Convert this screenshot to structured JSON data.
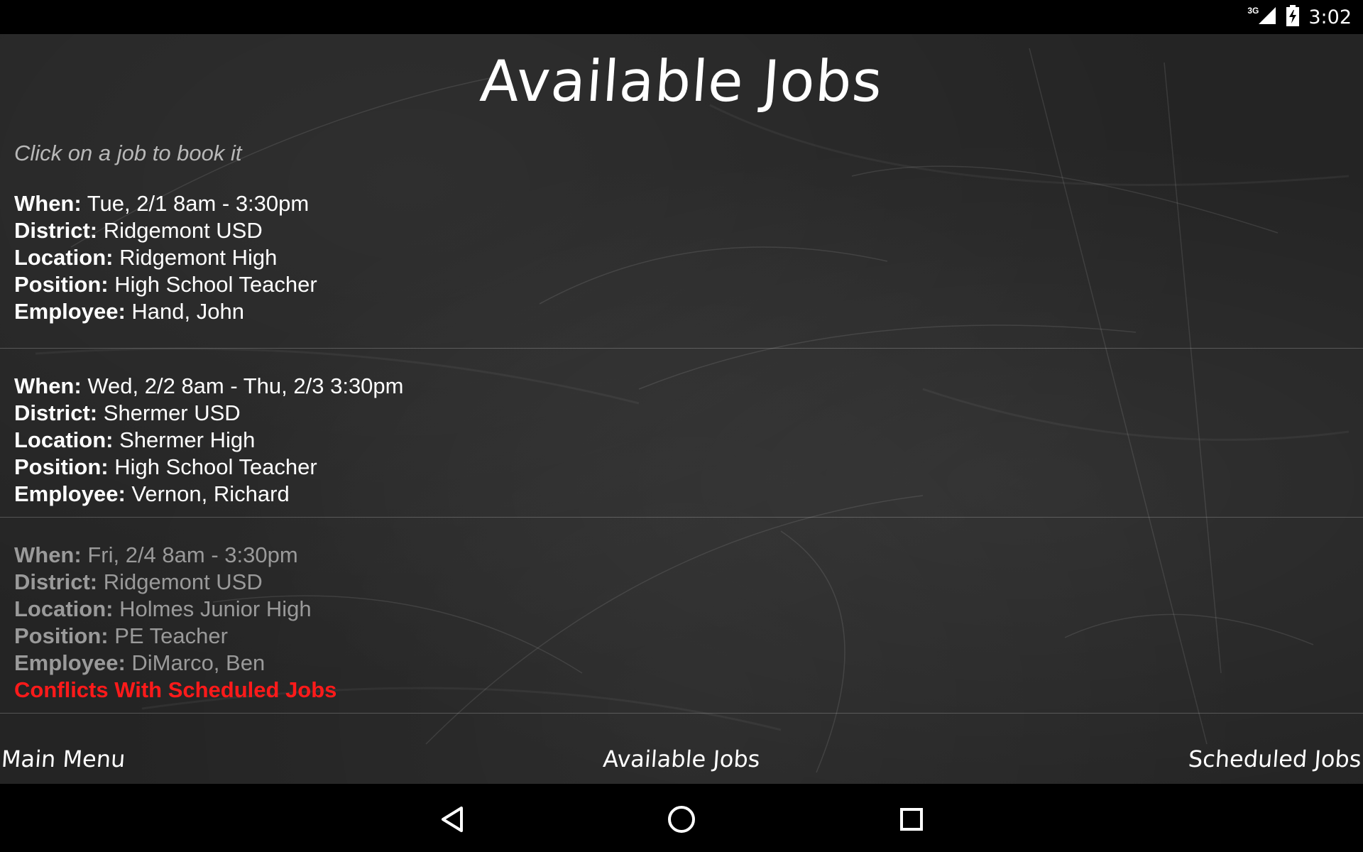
{
  "status_bar": {
    "network_type": "3G",
    "time": "3:02",
    "icons": [
      "signal-icon",
      "battery-icon"
    ]
  },
  "title": "Available Jobs",
  "hint": "Click on a job to book it",
  "labels": {
    "when": "When:",
    "district": "District:",
    "location": "Location:",
    "position": "Position:",
    "employee": "Employee:"
  },
  "jobs": [
    {
      "when": "Tue, 2/1 8am - 3:30pm",
      "district": "Ridgemont USD",
      "location": "Ridgemont High",
      "position": "High School Teacher",
      "employee": "Hand, John",
      "conflict": ""
    },
    {
      "when": "Wed, 2/2 8am - Thu, 2/3 3:30pm",
      "district": "Shermer USD",
      "location": "Shermer High",
      "position": "High School Teacher",
      "employee": "Vernon, Richard",
      "conflict": ""
    },
    {
      "when": "Fri, 2/4 8am - 3:30pm",
      "district": "Ridgemont USD",
      "location": "Holmes Junior High",
      "position": "PE Teacher",
      "employee": "DiMarco, Ben",
      "conflict": "Conflicts With Scheduled Jobs"
    }
  ],
  "bottom_nav": {
    "main_menu": "Main Menu",
    "available_jobs": "Available Jobs",
    "scheduled_jobs": "Scheduled Jobs"
  },
  "android_nav": [
    "back-icon",
    "home-icon",
    "recents-icon"
  ],
  "colors": {
    "conflict": "#ff1a1a",
    "board": "#242424",
    "disabled_text": "#9a9a9a"
  }
}
